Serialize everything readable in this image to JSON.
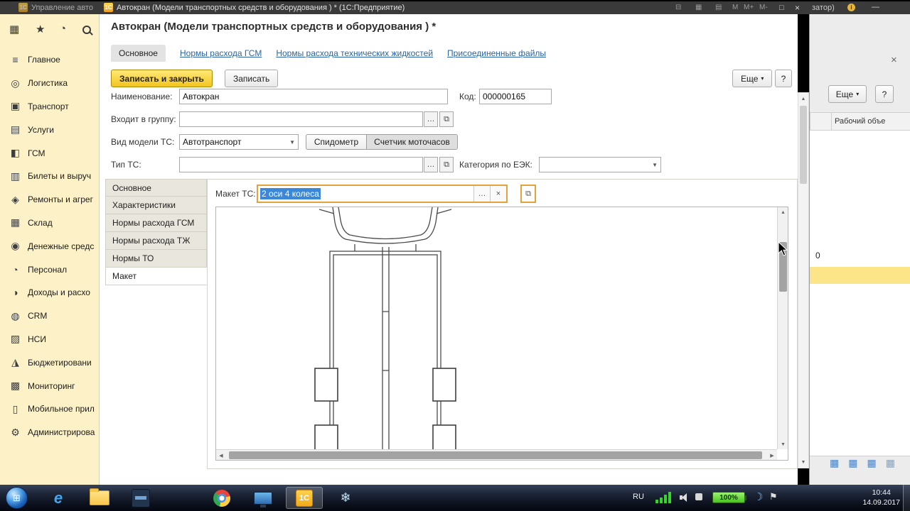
{
  "titlebar": {
    "background_tab": "Управление авто",
    "badge": "1С",
    "title": "Автокран (Модели транспортных средств и оборудования ) *  (1С:Предприятие)",
    "icons": {
      "print": "⊟",
      "calendar": "▦",
      "calculator": "▤"
    },
    "memory": [
      "M",
      "M+",
      "M-"
    ],
    "maximize": "□",
    "close": "×",
    "right_fragment": "затор)",
    "info_badge": "i",
    "minimize_dash": "—"
  },
  "glyphs": {
    "up": "▲",
    "down": "▼",
    "left": "◀",
    "right": "▶",
    "dropdown": "▼",
    "small_down": "▾",
    "dots": "…",
    "clear": "×",
    "open": "⧉",
    "menu_grid": "▦",
    "star": "★",
    "history": "◔"
  },
  "sidebar": {
    "items": [
      {
        "label": "Главное",
        "glyph": "≡"
      },
      {
        "label": "Логистика",
        "glyph": "◎"
      },
      {
        "label": "Транспорт",
        "glyph": "▣"
      },
      {
        "label": "Услуги",
        "glyph": "▤"
      },
      {
        "label": "ГСМ",
        "glyph": "◧"
      },
      {
        "label": "Билеты и выруч",
        "glyph": "▥"
      },
      {
        "label": "Ремонты и агрег",
        "glyph": "◈"
      },
      {
        "label": "Склад",
        "glyph": "▦"
      },
      {
        "label": "Денежные средс",
        "glyph": "◉"
      },
      {
        "label": "Персонал",
        "glyph": "◔"
      },
      {
        "label": "Доходы и расхо",
        "glyph": "◑"
      },
      {
        "label": "CRM",
        "glyph": "◍"
      },
      {
        "label": "НСИ",
        "glyph": "▨"
      },
      {
        "label": "Бюджетировани",
        "glyph": "◮"
      },
      {
        "label": "Мониторинг",
        "glyph": "▩"
      },
      {
        "label": "Мобильное прил",
        "glyph": "▯"
      },
      {
        "label": "Администрирова",
        "glyph": "⚙"
      }
    ]
  },
  "main": {
    "title": "Автокран (Модели транспортных средств и оборудования ) *",
    "tabs": [
      {
        "label": "Основное"
      },
      {
        "label": "Нормы расхода ГСМ"
      },
      {
        "label": "Нормы расхода технических жидкостей"
      },
      {
        "label": "Присоединенные файлы"
      }
    ],
    "buttons": {
      "save_close": "Записать и закрыть",
      "save": "Записать",
      "more": "Еще",
      "help": "?"
    },
    "form": {
      "name_label": "Наименование:",
      "name_value": "Автокран",
      "code_label": "Код:",
      "code_value": "000000165",
      "group_label": "Входит в группу:",
      "kind_label": "Вид модели ТС:",
      "kind_value": "Автотранспорт",
      "speedometer": "Спидометр",
      "hours": "Счетчик моточасов",
      "type_label": "Тип ТС:",
      "eek_label": "Категория по ЕЭК:"
    },
    "inner_tabs": [
      {
        "label": "Основное"
      },
      {
        "label": "Характеристики"
      },
      {
        "label": "Нормы расхода ГСМ"
      },
      {
        "label": "Нормы расхода ТЖ"
      },
      {
        "label": "Нормы ТО"
      },
      {
        "label": "Макет"
      }
    ],
    "maket": {
      "label": "Макет ТС:",
      "value": "2 оси 4 колеса"
    }
  },
  "right_panel": {
    "close": "×",
    "more": "Еще",
    "help": "?",
    "col_header": "Рабочий объе",
    "cell_value": "0"
  },
  "taskbar": {
    "lang": "RU",
    "battery": "100%",
    "time": "10:44",
    "date": "14.09.2017",
    "start_glyph": "⊞",
    "ie_glyph": "e",
    "onec_badge": "1С",
    "snowflake_glyph": "❄"
  }
}
